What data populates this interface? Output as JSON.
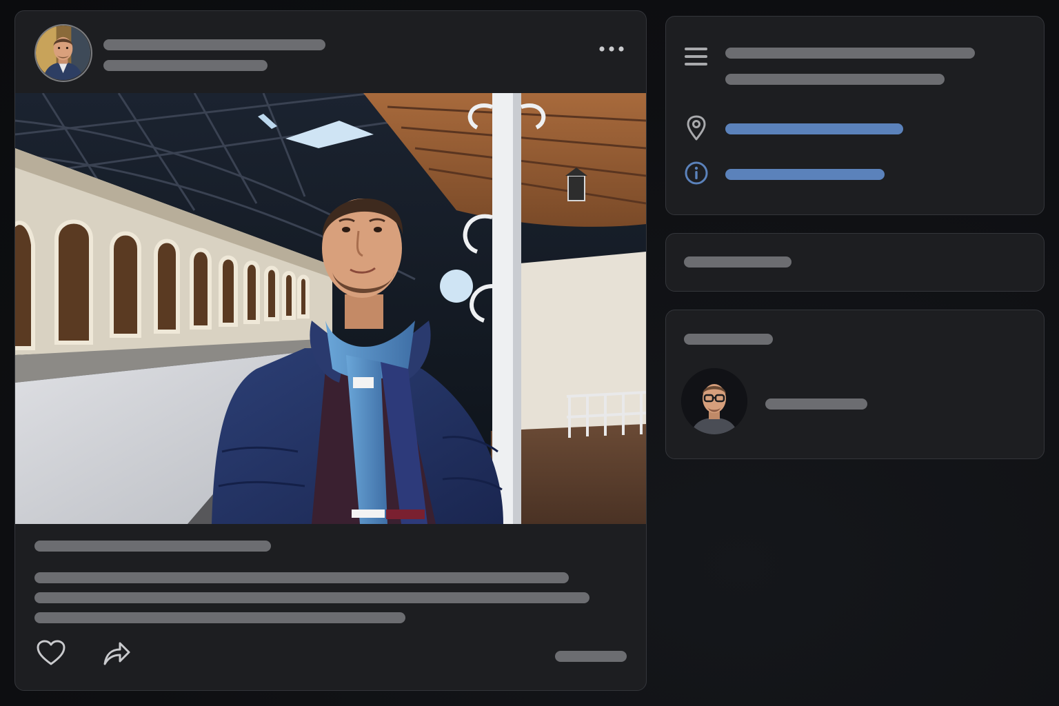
{
  "post": {
    "author_avatar": "author-avatar-image",
    "more_icon": "more-horizontal-icon",
    "photo": "man-at-train-station-photo",
    "like_icon": "heart-icon",
    "share_icon": "share-arrow-icon"
  },
  "about_panel": {
    "menu_icon": "menu-lines-icon",
    "location_icon": "location-pin-icon",
    "info_icon": "info-circle-icon"
  },
  "suggested_panel": {
    "avatar": "glasses-man-avatar-image"
  },
  "colors": {
    "background": "#0e0f12",
    "card": "#1d1e21",
    "card_border": "#34363b",
    "placeholder": "#6c6d71",
    "accent": "#5b82bb"
  }
}
